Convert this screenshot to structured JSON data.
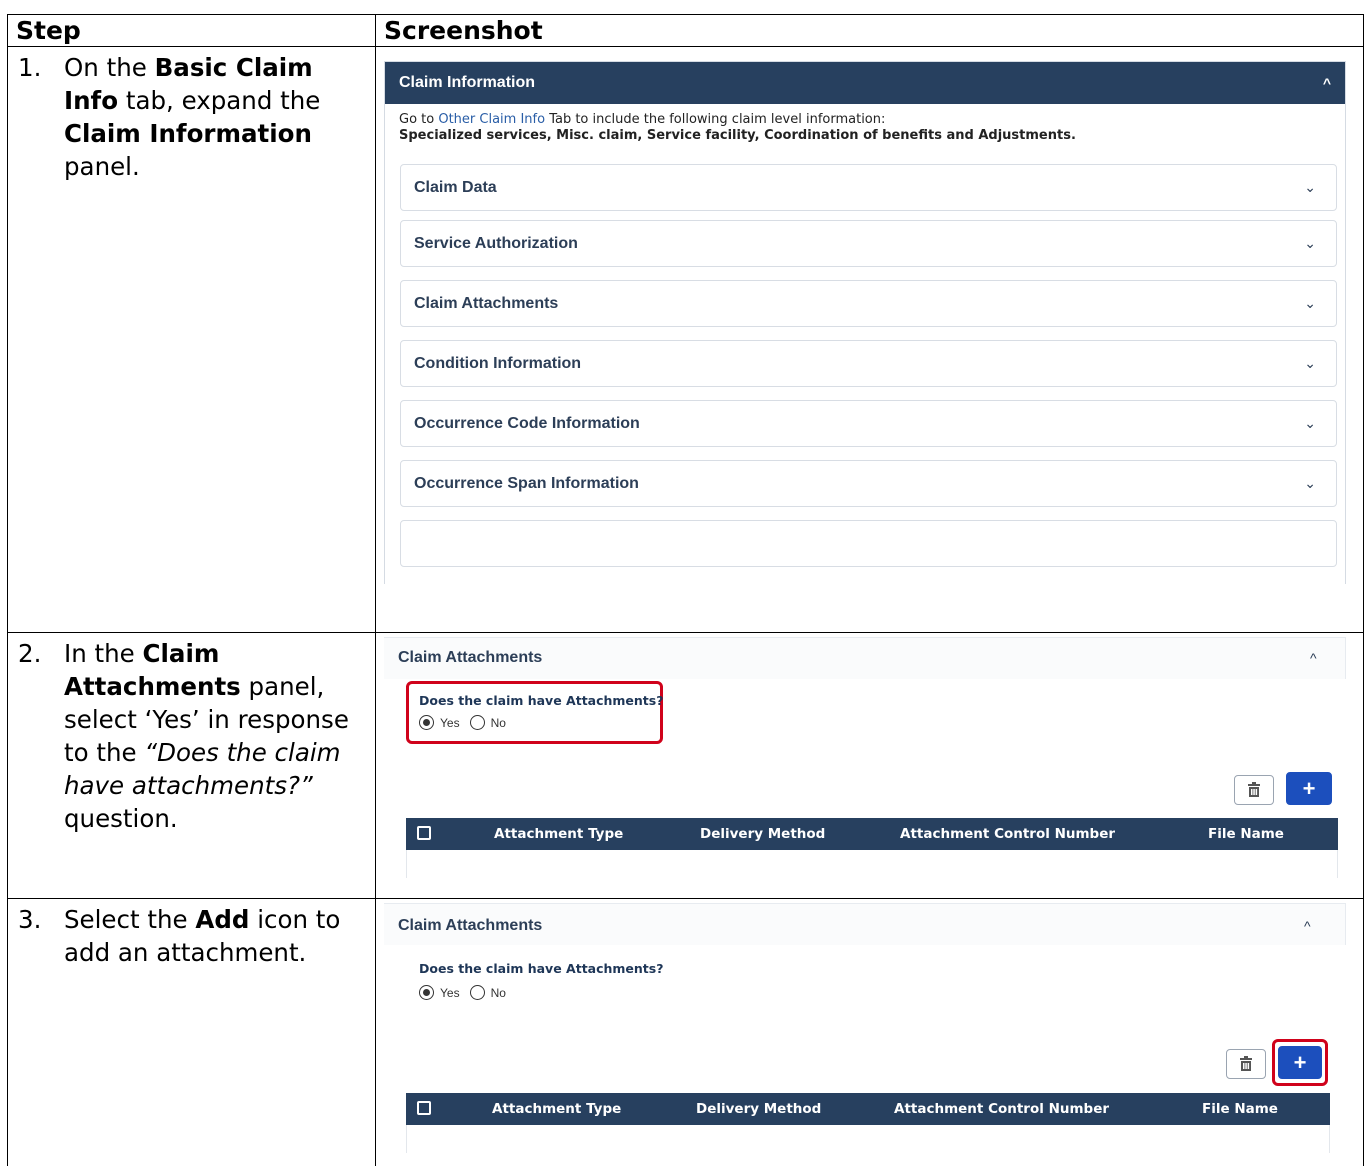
{
  "table": {
    "header_step": "Step",
    "header_screenshot": "Screenshot"
  },
  "steps": [
    {
      "num": "1.",
      "parts": [
        "On the ",
        "Basic Claim Info",
        " tab, expand the ",
        "Claim Information",
        " panel."
      ]
    },
    {
      "num": "2.",
      "parts": [
        "In the ",
        "Claim Attachments",
        " panel, select ‘Yes’ in response to the ",
        "“Does the claim have attachments?”",
        " question."
      ]
    },
    {
      "num": "3.",
      "parts": [
        "Select the ",
        "Add",
        " icon to add an attachment."
      ]
    }
  ],
  "shot1": {
    "header": "Claim Information",
    "note_prefix": "Go to ",
    "note_link": "Other Claim Info",
    "note_suffix": " Tab to include the following claim level information:",
    "note_bold": "Specialized services, Misc. claim, Service facility, Coordination of benefits and Adjustments.",
    "accordions": [
      "Claim Data",
      "Service Authorization",
      "Claim Attachments",
      "Condition Information",
      "Occurrence Code Information",
      "Occurrence Span Information"
    ]
  },
  "attachments": {
    "title": "Claim Attachments",
    "question": "Does the claim have Attachments?",
    "yes": "Yes",
    "no": "No",
    "columns": [
      "Attachment Type",
      "Delivery Method",
      "Attachment Control Number",
      "File Name"
    ]
  },
  "icons": {
    "chevron_up": "^",
    "chevron_down": "⌄",
    "add": "+",
    "trash": "trash-icon"
  },
  "colors": {
    "header_bg": "#27405f",
    "add_button": "#1c4fbd",
    "highlight": "#d0021b",
    "link": "#2a5ea7"
  }
}
